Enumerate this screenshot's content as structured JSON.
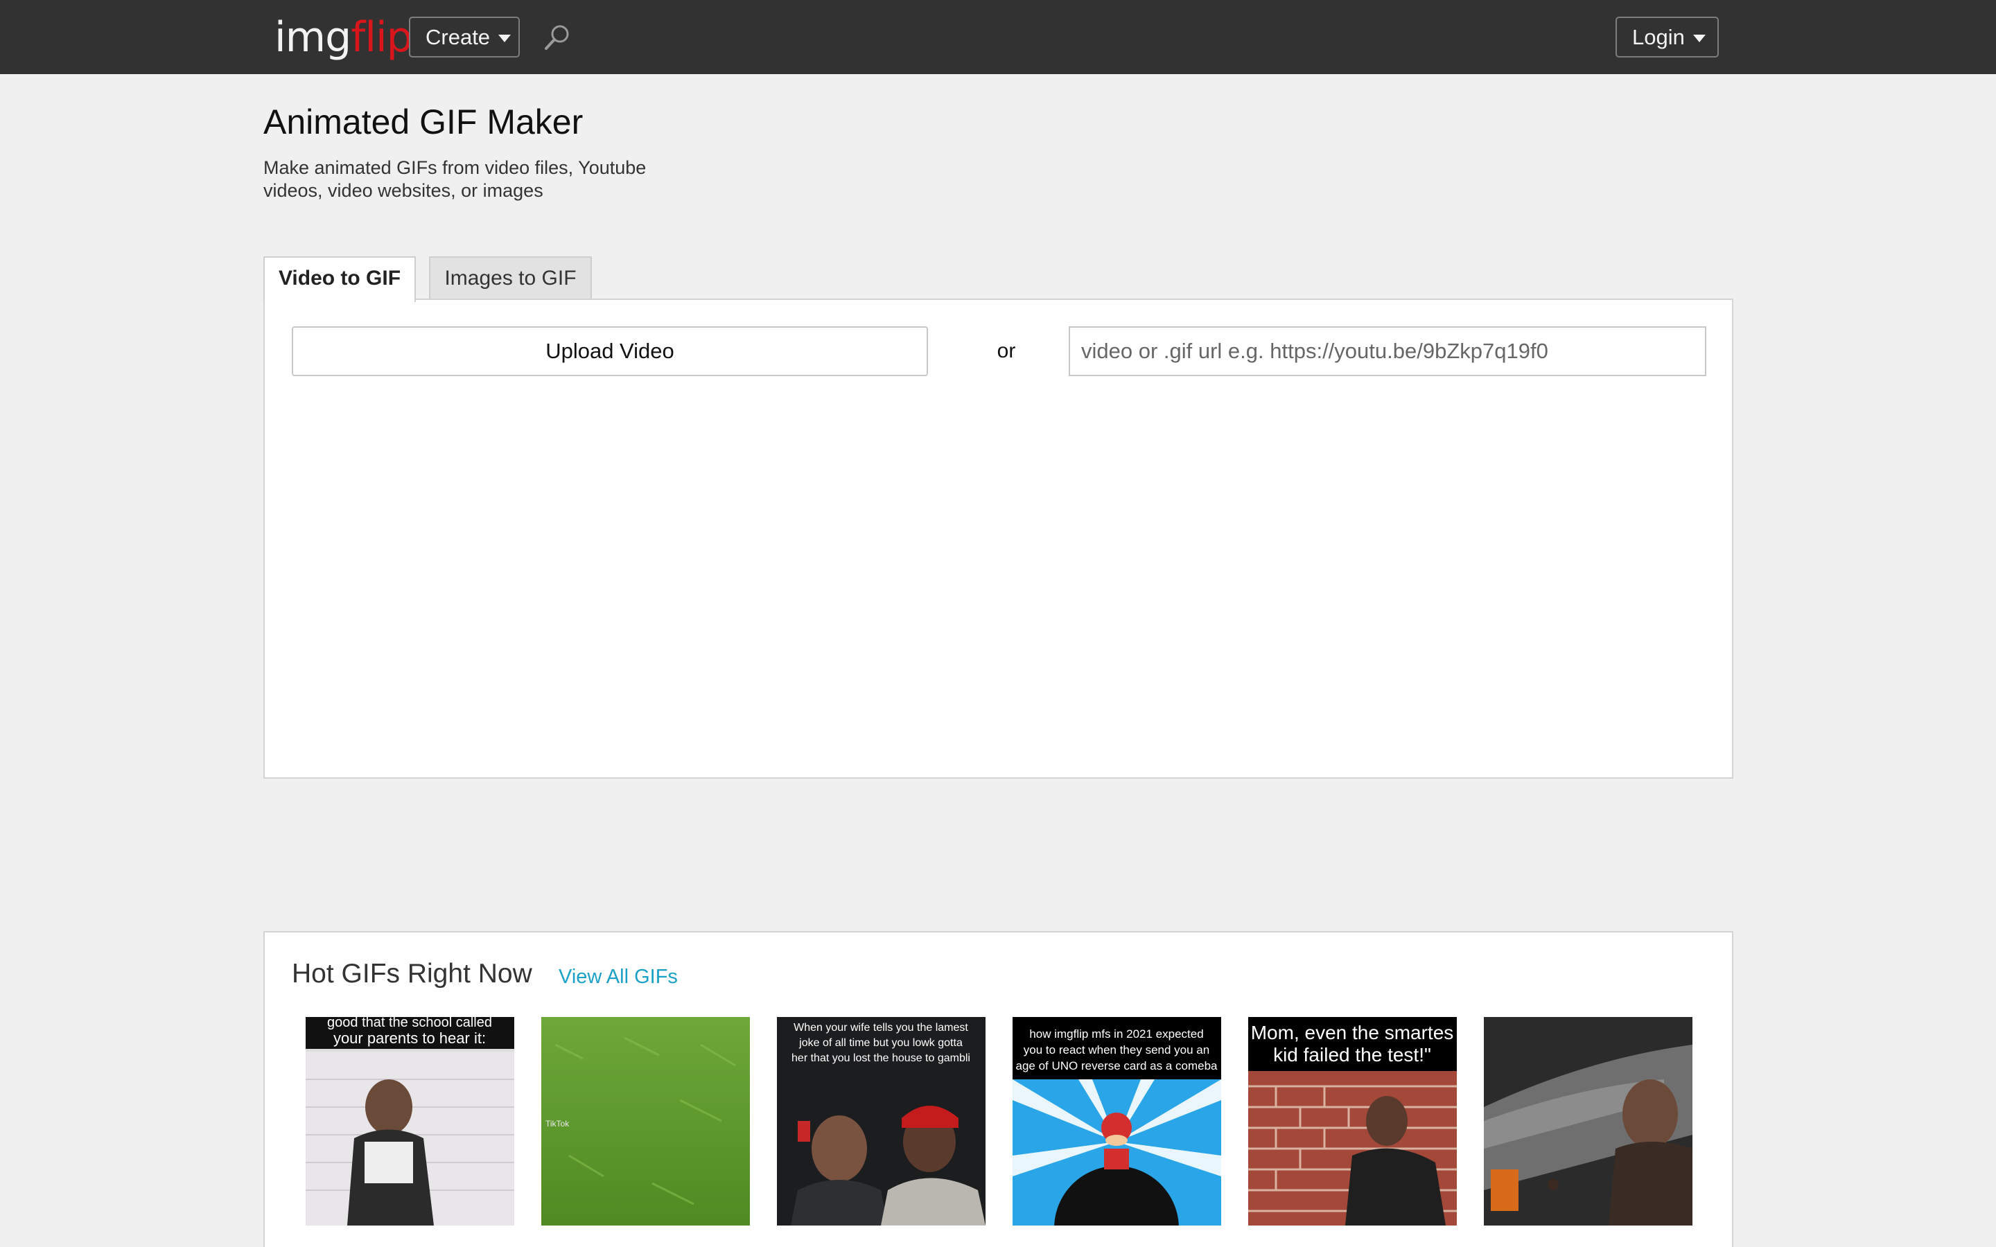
{
  "nav": {
    "logo_part1": "img",
    "logo_part2": "flip",
    "create_label": "Create",
    "login_label": "Login"
  },
  "header": {
    "title": "Animated GIF Maker",
    "subtitle": "Make animated GIFs from video files, Youtube videos, video websites, or images"
  },
  "tabs": [
    {
      "label": "Video to GIF",
      "active": true
    },
    {
      "label": "Images to GIF",
      "active": false
    }
  ],
  "upload": {
    "button_label": "Upload Video",
    "or_label": "or",
    "url_placeholder": "video or .gif url e.g. https://youtu.be/9bZkp7q19f0"
  },
  "hot": {
    "title": "Hot GIFs Right Now",
    "view_all_label": "View All GIFs",
    "gifs": [
      {
        "caption_lines": [
          "good that the school called",
          "your parents to hear it:"
        ]
      },
      {
        "caption_lines": [
          "TikTok"
        ]
      },
      {
        "caption_lines": [
          "When your wife tells you the lamest",
          "joke of all time but you lowk gotta",
          "her that you lost the house to gambli"
        ]
      },
      {
        "caption_lines": [
          "how imgflip mfs in 2021 expected",
          "you to react when they send you an",
          "age of UNO reverse card as a comeba"
        ]
      },
      {
        "caption_lines": [
          "Mom, even the smartes",
          "kid failed the test!\""
        ]
      },
      {
        "caption_lines": []
      }
    ]
  },
  "colors": {
    "topbar": "#323232",
    "logo_accent": "#d8161b",
    "link": "#1ba1c6",
    "background": "#f0f0f0"
  }
}
